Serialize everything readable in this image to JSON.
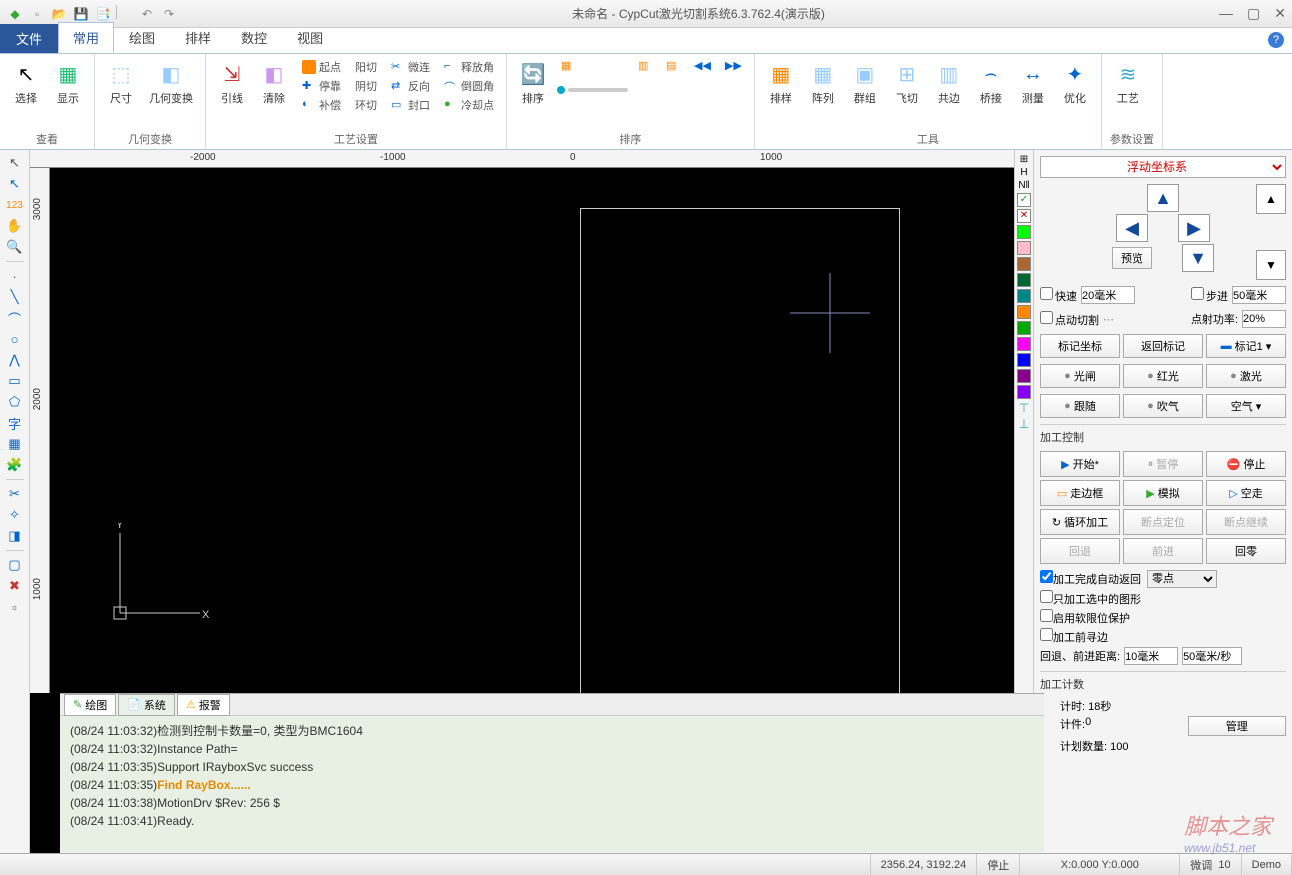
{
  "title": "未命名 - CypCut激光切割系统6.3.762.4(演示版)",
  "tabs": {
    "file": "文件",
    "common": "常用",
    "draw": "绘图",
    "layout": "排样",
    "nc": "数控",
    "view": "视图"
  },
  "ribbon": {
    "view_group": "查看",
    "select": "选择",
    "show": "显示",
    "geom_group": "几何变换",
    "size": "尺寸",
    "transform": "几何变换",
    "lead": "引线",
    "clear": "清除",
    "tech_group": "工艺设置",
    "start": "起点",
    "yang": "阳切",
    "micro": "微连",
    "release": "释放角",
    "dock": "停靠",
    "yin": "阴切",
    "reverse": "反向",
    "chamfer": "倒圆角",
    "comp": "补偿",
    "ring": "环切",
    "seal": "封口",
    "cool": "冷却点",
    "sort_group": "排序",
    "sort": "排序",
    "layout2": "排样",
    "array": "阵列",
    "group": "群组",
    "fly": "飞切",
    "trim": "共边",
    "bridge": "桥接",
    "measure": "测量",
    "optimize": "优化",
    "tools_group": "工具",
    "param_group": "参数设置",
    "tech": "工艺"
  },
  "ruler_h": [
    "-2000",
    "-1000",
    "0",
    "1000"
  ],
  "ruler_v": [
    "3000",
    "2000",
    "1000"
  ],
  "right": {
    "coord": "浮动坐标系",
    "preview": "预览",
    "fast": "快速",
    "fast_val": "20毫米",
    "step": "步进",
    "step_val": "50毫米",
    "jogcut": "点动切割",
    "spotpower": "点射功率:",
    "spotpower_val": "20%",
    "mark": "标记坐标",
    "return_mark": "返回标记",
    "mark1": "标记1",
    "shutter": "光闸",
    "red": "红光",
    "laser": "激光",
    "follow": "跟随",
    "blow": "吹气",
    "air": "空气",
    "proc_ctrl": "加工控制",
    "start": "开始*",
    "pause": "暂停",
    "stop": "停止",
    "frame": "走边框",
    "sim": "模拟",
    "dry": "空走",
    "loop": "循环加工",
    "bploc": "断点定位",
    "bpcont": "断点继续",
    "back": "回退",
    "fwd": "前进",
    "home": "回零",
    "opt1": "加工完成自动返回",
    "opt1v": "零点",
    "opt2": "只加工选中的图形",
    "opt3": "启用软限位保护",
    "opt4": "加工前寻边",
    "backfwd": "回退、前进距离:",
    "bf1": "10毫米",
    "bf2": "50毫米/秒",
    "count": "加工计数",
    "time": "计时:",
    "time_v": "18秒",
    "cnt": "计件:",
    "cnt_v": "0",
    "plan": "计划数量:",
    "plan_v": "100",
    "manage": "管理"
  },
  "logtabs": {
    "draw": "绘图",
    "sys": "系统",
    "alarm": "报警"
  },
  "log": [
    "(08/24 11:03:32)检测到控制卡数量=0, 类型为BMC1604",
    "(08/24 11:03:32)Instance Path=",
    "(08/24 11:03:35)Support IRayboxSvc success",
    "(08/24 11:03:35)",
    "(08/24 11:03:38)MotionDrv $Rev: 256 $",
    "(08/24 11:03:41)Ready."
  ],
  "log_highlight": "Find RayBox......",
  "status": {
    "coord": "2356.24, 3192.24",
    "state": "停止",
    "xy": "X:0.000 Y:0.000",
    "fine": "微调",
    "fine_v": "10",
    "demo": "Demo"
  },
  "watermark": "脚本之家",
  "watermark2": "www.jb51.net"
}
